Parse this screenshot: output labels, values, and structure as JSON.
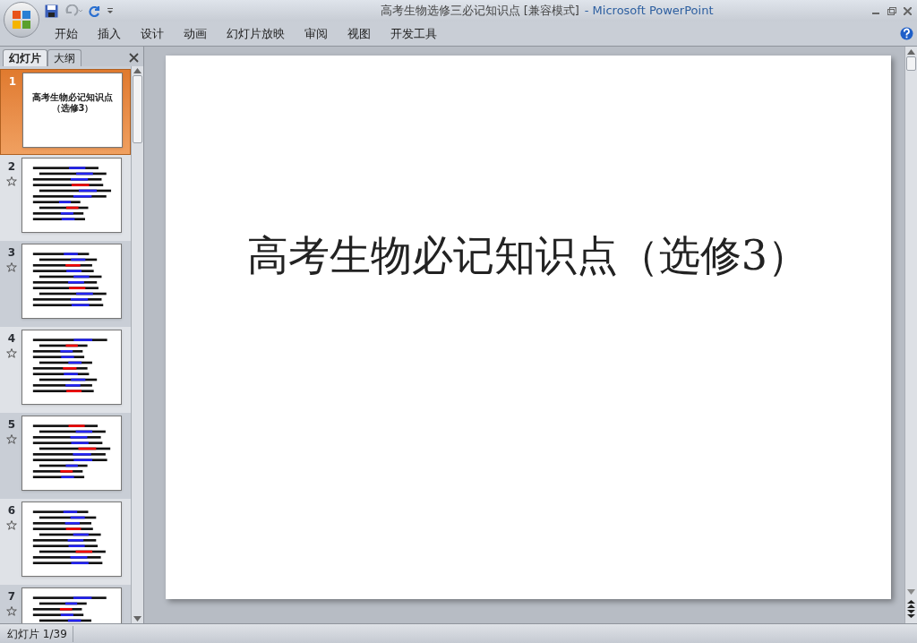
{
  "window": {
    "title": "高考生物选修三必记知识点 [兼容模式]",
    "app_name": "- Microsoft PowerPoint"
  },
  "ribbon_tabs": [
    {
      "label": "开始",
      "selected": false
    },
    {
      "label": "插入",
      "selected": false
    },
    {
      "label": "设计",
      "selected": false
    },
    {
      "label": "动画",
      "selected": false
    },
    {
      "label": "幻灯片放映",
      "selected": false
    },
    {
      "label": "审阅",
      "selected": false
    },
    {
      "label": "视图",
      "selected": false
    },
    {
      "label": "开发工具",
      "selected": false
    }
  ],
  "pane_tabs": [
    {
      "label": "幻灯片",
      "selected": true
    },
    {
      "label": "大纲",
      "selected": false
    }
  ],
  "slides": [
    {
      "number": "1",
      "selected": true,
      "animated": false,
      "kind": "title",
      "title": "高考生物必记知识点（选修3）"
    },
    {
      "number": "2",
      "selected": false,
      "animated": true,
      "kind": "text"
    },
    {
      "number": "3",
      "selected": false,
      "animated": true,
      "kind": "text"
    },
    {
      "number": "4",
      "selected": false,
      "animated": true,
      "kind": "text"
    },
    {
      "number": "5",
      "selected": false,
      "animated": true,
      "kind": "text"
    },
    {
      "number": "6",
      "selected": false,
      "animated": true,
      "kind": "text"
    },
    {
      "number": "7",
      "selected": false,
      "animated": true,
      "kind": "text"
    }
  ],
  "current_slide": {
    "title": "高考生物必记知识点（选修3）"
  },
  "status_bar": {
    "slide_counter": "幻灯片 1/39"
  }
}
